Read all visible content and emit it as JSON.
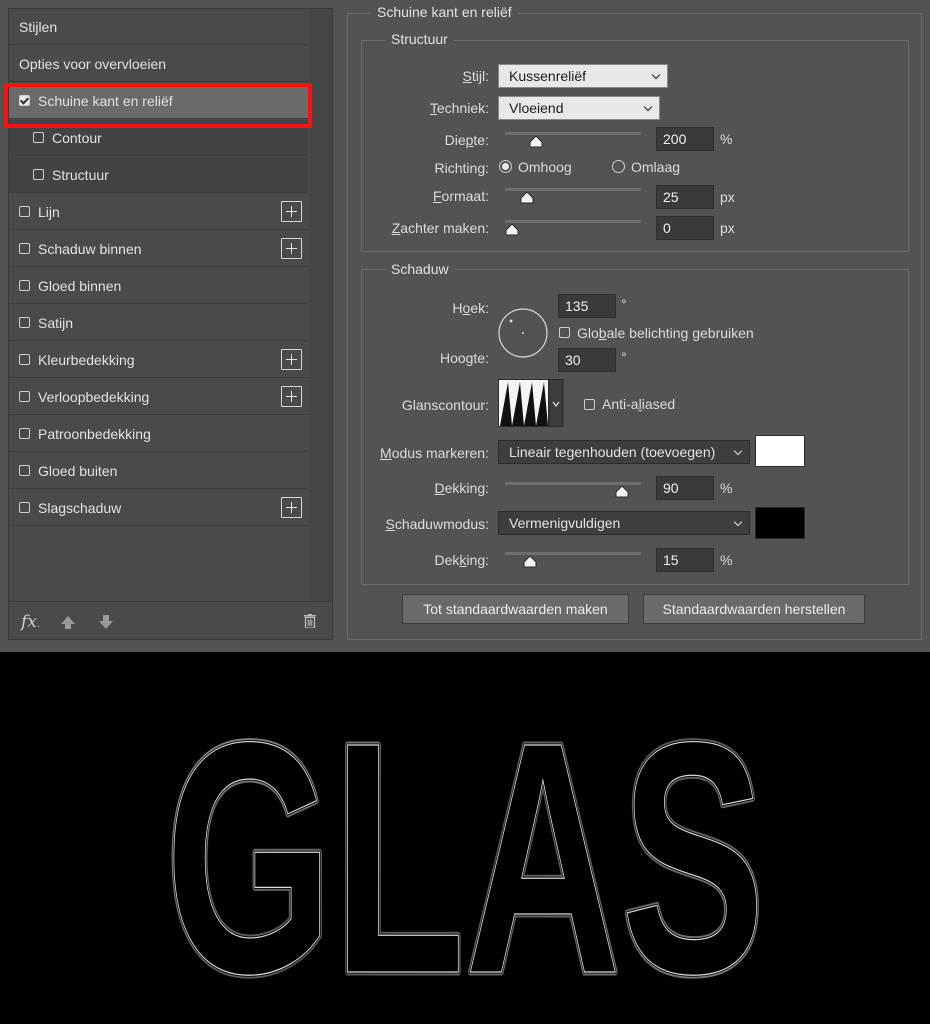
{
  "left_panel": {
    "items": [
      {
        "label": "Stijlen",
        "type": "head"
      },
      {
        "label": "Opties voor overvloeien",
        "type": "head"
      },
      {
        "label": "Schuine kant en reliëf",
        "type": "check",
        "checked": true,
        "selected": true
      },
      {
        "label": "Contour",
        "type": "subcheck",
        "checked": false
      },
      {
        "label": "Structuur",
        "type": "subcheck",
        "checked": false
      },
      {
        "label": "Lijn",
        "type": "check",
        "checked": false,
        "plus": true
      },
      {
        "label": "Schaduw binnen",
        "type": "check",
        "checked": false,
        "plus": true
      },
      {
        "label": "Gloed binnen",
        "type": "check",
        "checked": false
      },
      {
        "label": "Satijn",
        "type": "check",
        "checked": false
      },
      {
        "label": "Kleurbedekking",
        "type": "check",
        "checked": false,
        "plus": true
      },
      {
        "label": "Verloopbedekking",
        "type": "check",
        "checked": false,
        "plus": true
      },
      {
        "label": "Patroonbedekking",
        "type": "check",
        "checked": false
      },
      {
        "label": "Gloed buiten",
        "type": "check",
        "checked": false
      },
      {
        "label": "Slagschaduw",
        "type": "check",
        "checked": false,
        "plus": true
      }
    ],
    "footer": {
      "fx_label": "fx",
      "fx_sub": "."
    }
  },
  "bevel": {
    "title": "Schuine kant en reliëf",
    "structure": {
      "legend": "Structuur",
      "style_label": "Stijl:",
      "style_value": "Kussenreliëf",
      "technique_label": "Techniek:",
      "technique_value": "Vloeiend",
      "depth_label": "Diepte:",
      "depth_value": "200",
      "depth_fraction": 0.2,
      "depth_unit": "%",
      "direction_label": "Richting:",
      "direction_up": "Omhoog",
      "direction_down": "Omlaag",
      "direction_selected": "up",
      "size_label": "Formaat:",
      "size_value": "25",
      "size_fraction": 0.12,
      "size_unit": "px",
      "soften_label": "Zachter maken:",
      "soften_value": "0",
      "soften_fraction": 0.0,
      "soften_unit": "px"
    },
    "shading": {
      "legend": "Schaduw",
      "angle_label": "Hoek:",
      "angle_value": "135",
      "angle_unit": "°",
      "global_light_label": "Globale belichting gebruiken",
      "global_light_checked": false,
      "altitude_label": "Hoogte:",
      "altitude_value": "30",
      "altitude_unit": "°",
      "gloss_label": "Glanscontour:",
      "antialias_label": "Anti-aliased",
      "antialias_checked": false,
      "highlight_mode_label": "Modus markeren:",
      "highlight_mode_value": "Lineair tegenhouden (toevoegen)",
      "highlight_color": "#ffffff",
      "highlight_opacity_label": "Dekking:",
      "highlight_opacity_value": "90",
      "highlight_opacity_fraction": 0.9,
      "highlight_opacity_unit": "%",
      "shadow_mode_label": "Schaduwmodus:",
      "shadow_mode_value": "Vermenigvuldigen",
      "shadow_color": "#000000",
      "shadow_opacity_label": "Dekking:",
      "shadow_opacity_value": "15",
      "shadow_opacity_fraction": 0.15,
      "shadow_opacity_unit": "%"
    },
    "buttons": {
      "make_default": "Tot standaardwaarden maken",
      "reset_default": "Standaardwaarden herstellen"
    }
  },
  "preview": {
    "text": "GLAS"
  }
}
